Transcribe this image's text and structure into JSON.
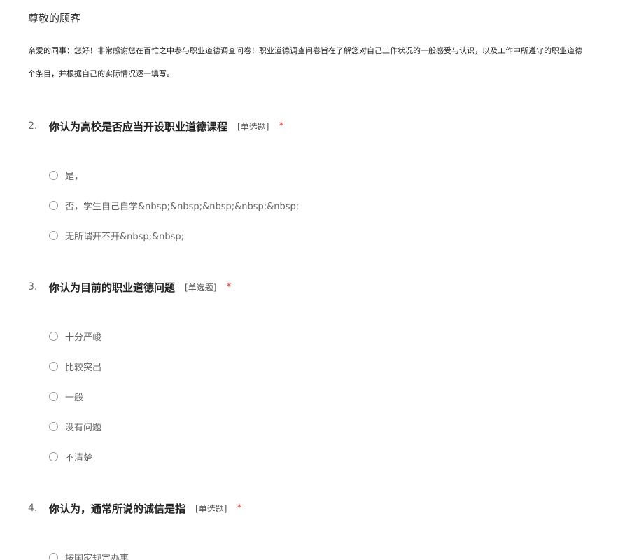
{
  "survey": {
    "greeting": "尊敬的顾客",
    "intro_line1": "亲爱的同事：您好！非常感谢您在百忙之中参与职业道德调查问卷！职业道德调查问卷旨在了解您对自己工作状况的一般感受与认识，以及工作中所遵守的职业道德",
    "intro_line2": "个条目，并根据自己的实际情况逐一填写。"
  },
  "questions": [
    {
      "number": "2.",
      "title": "你认为高校是否应当开设职业道德课程",
      "type": "[单选题]",
      "required": "*",
      "options": [
        "是，",
        "否，学生自己自学&nbsp;&nbsp;&nbsp;&nbsp;&nbsp;",
        "无所谓开不开&nbsp;&nbsp;"
      ]
    },
    {
      "number": "3.",
      "title": "你认为目前的职业道德问题",
      "type": "[单选题]",
      "required": "*",
      "options": [
        "十分严峻",
        "比较突出",
        "一般",
        "没有问题",
        "不清楚"
      ]
    },
    {
      "number": "4.",
      "title": "你认为，通常所说的诚信是指",
      "type": "[单选题]",
      "required": "*",
      "options": [
        "按国家规定办事"
      ]
    }
  ]
}
